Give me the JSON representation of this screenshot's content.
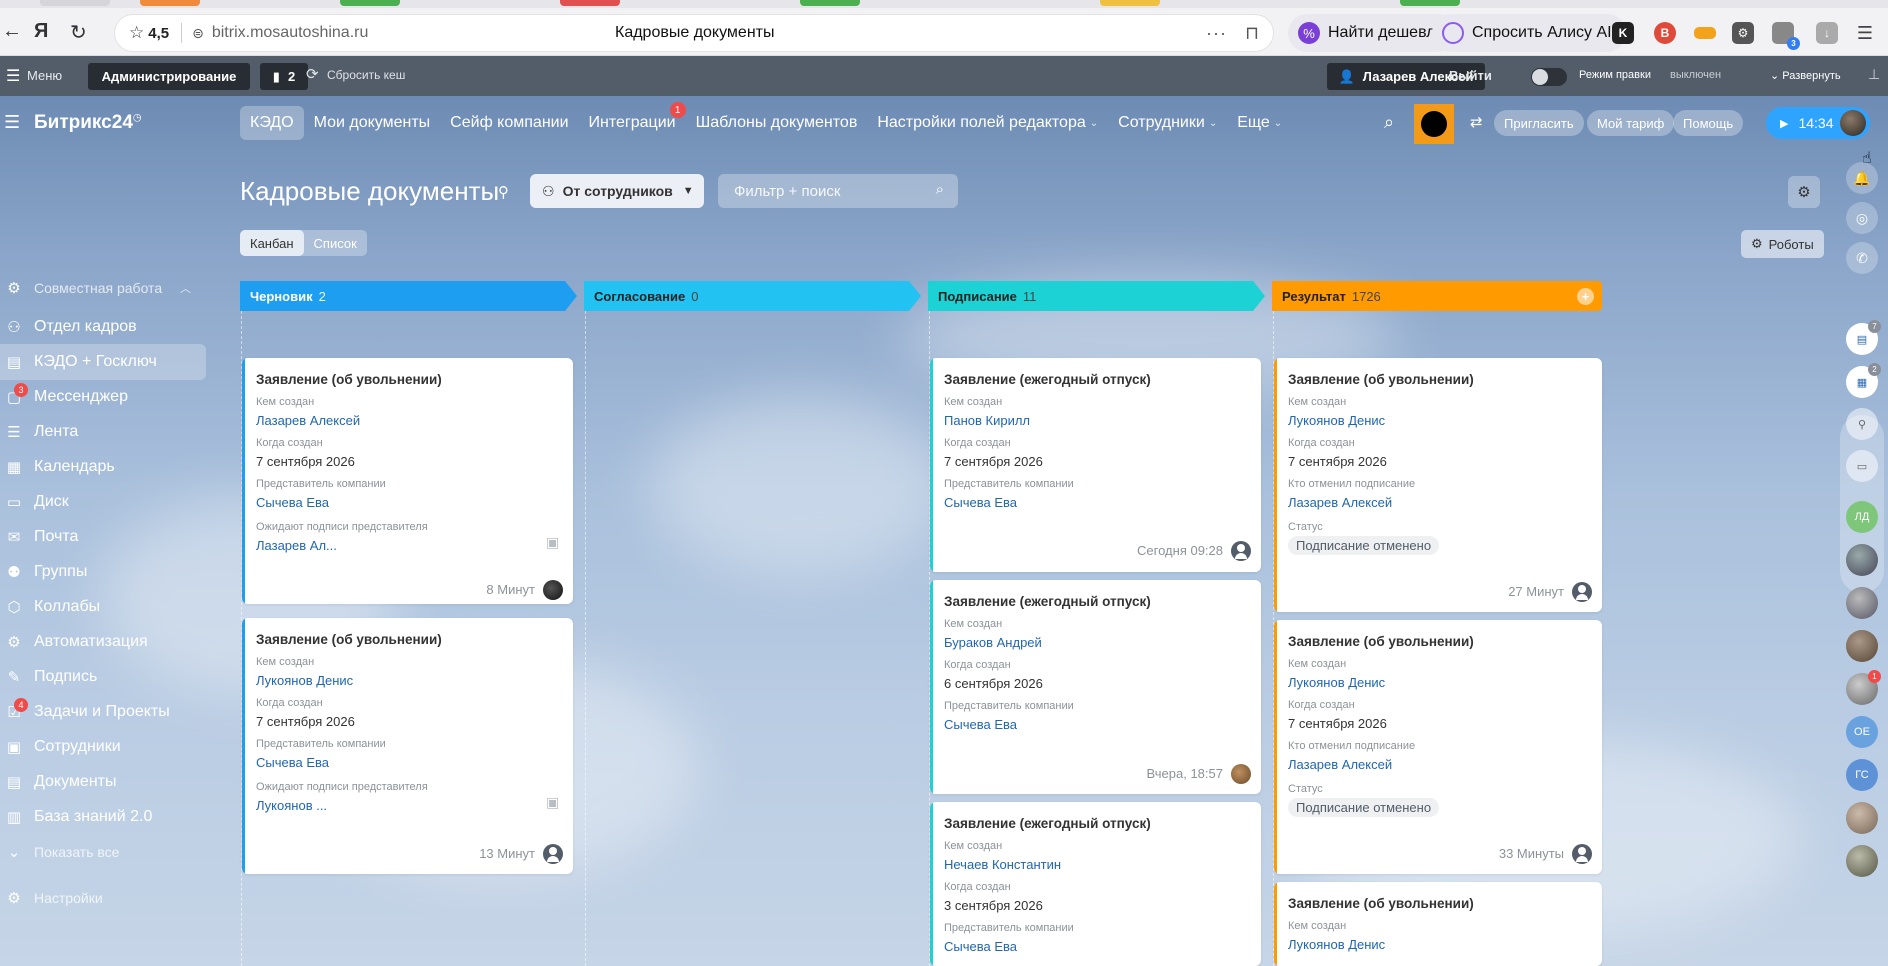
{
  "browser": {
    "rating": "4,5",
    "url": "bitrix.mosautoshina.ru",
    "page_title": "Кадровые документы",
    "cheaper_label": "Найти дешевле",
    "alice_label": "Спросить Алису AI",
    "back_icon": "arrow-left-icon",
    "reload_icon": "reload-icon",
    "ext_badge": "3"
  },
  "admin_bar": {
    "menu_label": "Меню",
    "admin_label": "Администрирование",
    "notify_count": "2",
    "reset_cache_label": "Сбросить кеш",
    "user_label": "Лазарев Алексей",
    "logout_label": "Выйти",
    "edit_mode_label": "Режим правки",
    "edit_mode_value": "выключен",
    "expand_label": "Развернуть"
  },
  "sidebar": {
    "logo": "Битрикс24",
    "group_label": "Совместная работа",
    "items": [
      {
        "label": "Отдел кадров",
        "icon": "people-icon",
        "badge": ""
      },
      {
        "label": "КЭДО + Госключ",
        "icon": "document-edit-icon",
        "badge": ""
      },
      {
        "label": "Мессенджер",
        "icon": "chat-icon",
        "badge": "3"
      },
      {
        "label": "Лента",
        "icon": "feed-icon",
        "badge": ""
      },
      {
        "label": "Календарь",
        "icon": "calendar-icon",
        "badge": ""
      },
      {
        "label": "Диск",
        "icon": "disk-icon",
        "badge": ""
      },
      {
        "label": "Почта",
        "icon": "mail-icon",
        "badge": ""
      },
      {
        "label": "Группы",
        "icon": "groups-icon",
        "badge": ""
      },
      {
        "label": "Коллабы",
        "icon": "collab-icon",
        "badge": ""
      },
      {
        "label": "Автоматизация",
        "icon": "robot-icon",
        "badge": ""
      },
      {
        "label": "Подпись",
        "icon": "signature-icon",
        "badge": ""
      },
      {
        "label": "Задачи и Проекты",
        "icon": "tasks-icon",
        "badge": "4"
      },
      {
        "label": "Сотрудники",
        "icon": "employees-icon",
        "badge": ""
      },
      {
        "label": "Документы",
        "icon": "documents-icon",
        "badge": ""
      },
      {
        "label": "База знаний 2.0",
        "icon": "knowledge-icon",
        "badge": ""
      }
    ],
    "show_all_label": "Показать все",
    "settings_label": "Настройки"
  },
  "topnav": {
    "items": [
      {
        "label": "КЭДО",
        "badge": "",
        "caret": false
      },
      {
        "label": "Мои документы",
        "badge": "",
        "caret": false
      },
      {
        "label": "Сейф компании",
        "badge": "",
        "caret": false
      },
      {
        "label": "Интеграции",
        "badge": "1",
        "caret": false
      },
      {
        "label": "Шаблоны документов",
        "badge": "",
        "caret": false
      },
      {
        "label": "Настройки полей редактора",
        "badge": "",
        "caret": true
      },
      {
        "label": "Сотрудники",
        "badge": "",
        "caret": true
      },
      {
        "label": "Еще",
        "badge": "",
        "caret": true
      }
    ],
    "invite_label": "Пригласить",
    "tariff_label": "Мой тариф",
    "help_label": "Помощь",
    "clock": "14:34"
  },
  "page": {
    "title": "Кадровые документы",
    "source_filter": "От сотрудников",
    "search_placeholder": "Фильтр + поиск",
    "view_kanban": "Канбан",
    "view_list": "Список",
    "robots_label": "Роботы"
  },
  "columns": [
    {
      "name": "Черновик",
      "count": "2",
      "color": "#1e9ef0"
    },
    {
      "name": "Согласование",
      "count": "0",
      "color": "#22c3f3"
    },
    {
      "name": "Подписание",
      "count": "11",
      "color": "#1dd2d4"
    },
    {
      "name": "Результат",
      "count": "1726",
      "color": "#ff9a00"
    }
  ],
  "cards": {
    "draft": [
      {
        "title": "Заявление (об увольнении)",
        "created_by_label": "Кем создан",
        "created_by": "Лазарев Алексей",
        "created_at_label": "Когда создан",
        "created_at": "7 сентября 2026",
        "rep_label": "Представитель компании",
        "rep": "Сычева Ева",
        "awaiting_label": "Ожидают подписи представителя",
        "awaiting": "Лазарев Ал...",
        "time": "8 Минут"
      },
      {
        "title": "Заявление (об увольнении)",
        "created_by_label": "Кем создан",
        "created_by": "Лукоянов Денис",
        "created_at_label": "Когда создан",
        "created_at": "7 сентября 2026",
        "rep_label": "Представитель компании",
        "rep": "Сычева Ева",
        "awaiting_label": "Ожидают подписи представителя",
        "awaiting": "Лукоянов ...",
        "time": "13 Минут"
      }
    ],
    "signing": [
      {
        "title": "Заявление (ежегодный отпуск)",
        "created_by_label": "Кем создан",
        "created_by": "Панов Кирилл",
        "created_at_label": "Когда создан",
        "created_at": "7 сентября 2026",
        "rep_label": "Представитель компании",
        "rep": "Сычева Ева",
        "time": "Сегодня 09:28"
      },
      {
        "title": "Заявление (ежегодный отпуск)",
        "created_by_label": "Кем создан",
        "created_by": "Бураков Андрей",
        "created_at_label": "Когда создан",
        "created_at": "6 сентября 2026",
        "rep_label": "Представитель компании",
        "rep": "Сычева Ева",
        "time": "Вчера, 18:57"
      },
      {
        "title": "Заявление (ежегодный отпуск)",
        "created_by_label": "Кем создан",
        "created_by": "Нечаев Константин",
        "created_at_label": "Когда создан",
        "created_at": "3 сентября 2026",
        "rep_label": "Представитель компании",
        "rep": "Сычева Ева"
      }
    ],
    "result": [
      {
        "title": "Заявление (об увольнении)",
        "created_by_label": "Кем создан",
        "created_by": "Лукоянов Денис",
        "created_at_label": "Когда создан",
        "created_at": "7 сентября 2026",
        "cancelled_label": "Кто отменил подписание",
        "cancelled_by": "Лазарев Алексей",
        "status_label": "Статус",
        "status": "Подписание отменено",
        "time": "27 Минут"
      },
      {
        "title": "Заявление (об увольнении)",
        "created_by_label": "Кем создан",
        "created_by": "Лукоянов Денис",
        "created_at_label": "Когда создан",
        "created_at": "7 сентября 2026",
        "cancelled_label": "Кто отменил подписание",
        "cancelled_by": "Лазарев Алексей",
        "status_label": "Статус",
        "status": "Подписание отменено",
        "time": "33 Минуты"
      },
      {
        "title": "Заявление (об увольнении)",
        "created_by_label": "Кем создан",
        "created_by": "Лукоянов Денис"
      }
    ]
  },
  "rail": {
    "badge_1": "7",
    "badge_2": "2",
    "badge_3": "1",
    "initials": [
      "ЛД",
      "ОЕ",
      "ГС"
    ]
  }
}
